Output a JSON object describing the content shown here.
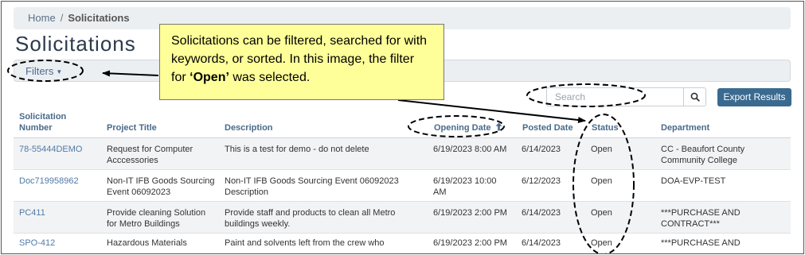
{
  "breadcrumb": {
    "home": "Home",
    "separator": "/",
    "current": "Solicitations"
  },
  "page_title": "Solicitations",
  "filters": {
    "label": "Filters",
    "caret": "▼"
  },
  "search": {
    "placeholder": "Search"
  },
  "export_label": "Export Results",
  "columns": {
    "number": [
      "Solicitation",
      "Number"
    ],
    "title": "Project Title",
    "description": "Description",
    "opening": "Opening Date",
    "posted": "Posted Date",
    "status": "Status",
    "department": "Department"
  },
  "sort": {
    "column": "opening",
    "direction": "ascending"
  },
  "rows": [
    {
      "number": "78-55444DEMO",
      "title": [
        "Request for Computer",
        "Acccessories"
      ],
      "description": [
        "This is a test for demo - do not delete"
      ],
      "opening": [
        "6/19/2023 8:00 AM"
      ],
      "posted": "6/14/2023",
      "status": "Open",
      "department": [
        "CC - Beaufort County",
        "Community College"
      ]
    },
    {
      "number": "Doc719958962",
      "title": [
        "Non-IT IFB Goods Sourcing",
        "Event 06092023"
      ],
      "description": [
        "Non-IT IFB Goods Sourcing Event 06092023",
        "Description"
      ],
      "opening": [
        "6/19/2023 10:00",
        "AM"
      ],
      "posted": "6/12/2023",
      "status": "Open",
      "department": [
        "DOA-EVP-TEST"
      ]
    },
    {
      "number": "PC411",
      "title": [
        "Provide cleaning Solution",
        "for Metro Buildings"
      ],
      "description": [
        "Provide staff and products to clean all Metro",
        "buildings weekly."
      ],
      "opening": [
        "6/19/2023 2:00 PM"
      ],
      "posted": "6/14/2023",
      "status": "Open",
      "department": [
        "***PURCHASE AND",
        "CONTRACT***"
      ]
    },
    {
      "number": "SPO-412",
      "title": [
        "Hazardous Materials"
      ],
      "description": [
        "Paint and solvents left from the crew who"
      ],
      "opening": [
        "6/19/2023 2:00 PM"
      ],
      "posted": "6/14/2023",
      "status": "Open",
      "department": [
        "***PURCHASE AND"
      ]
    }
  ],
  "callout": {
    "text_before": "Solicitations can be filtered, searched for with keywords, or sorted. In this image, the filter for ",
    "text_bold": "‘Open’",
    "text_after": " was selected."
  },
  "colors": {
    "link": "#4f7ba6",
    "header": "#4a6a8a",
    "export_button": "#3a6a8f",
    "callout_bg": "#ffff99"
  },
  "icons": {
    "search": "search-icon",
    "sort": "arrow-up-icon",
    "filters_caret": "caret-down-icon"
  }
}
